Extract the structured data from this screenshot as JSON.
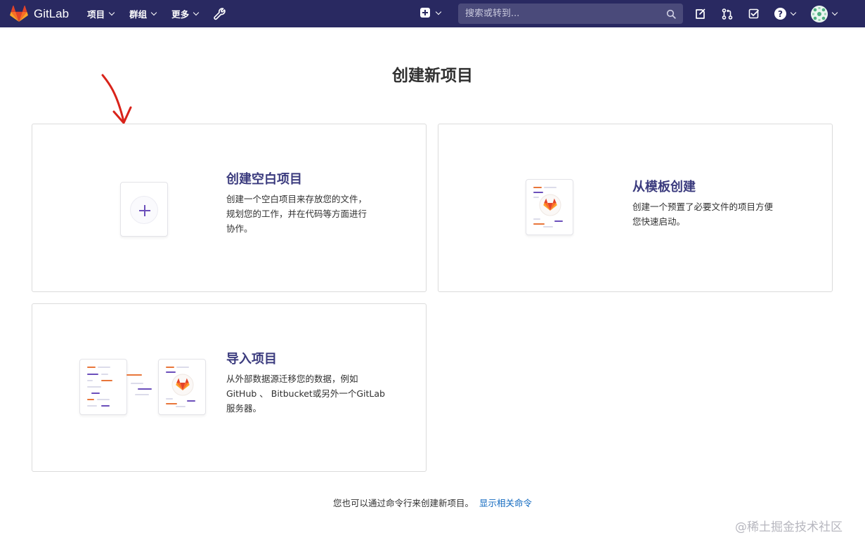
{
  "navbar": {
    "brand": "GitLab",
    "menu": [
      {
        "label": "项目"
      },
      {
        "label": "群组"
      },
      {
        "label": "更多"
      }
    ],
    "search_placeholder": "搜索或转到...",
    "help_symbol": "?"
  },
  "page": {
    "title": "创建新项目"
  },
  "cards": {
    "blank": {
      "title": "创建空白项目",
      "desc_lines": [
        "创建一个空白项目来存放您的文件，",
        "规划您的工作，并在代码等方面进行",
        "协作。"
      ]
    },
    "template": {
      "title": "从模板创建",
      "desc_lines": [
        "创建一个预置了必要文件的项目方便",
        "您快速启动。"
      ]
    },
    "import": {
      "title": "导入项目",
      "desc_lines": [
        "从外部数据源迁移您的数据，例如",
        "GitHub 、 Bitbucket或另外一个GitLab",
        "服务器。"
      ]
    }
  },
  "footer": {
    "text": "您也可以通过命令行来创建新项目。",
    "link": "显示相关命令"
  },
  "watermark": "@稀土掘金技术社区",
  "colors": {
    "navbar": "#292961",
    "card_title": "#3b3b7e",
    "link": "#1068bf",
    "accent_purple": "#6b4fbb",
    "accent_orange": "#e8763a",
    "annotation_arrow": "#d9231a"
  }
}
